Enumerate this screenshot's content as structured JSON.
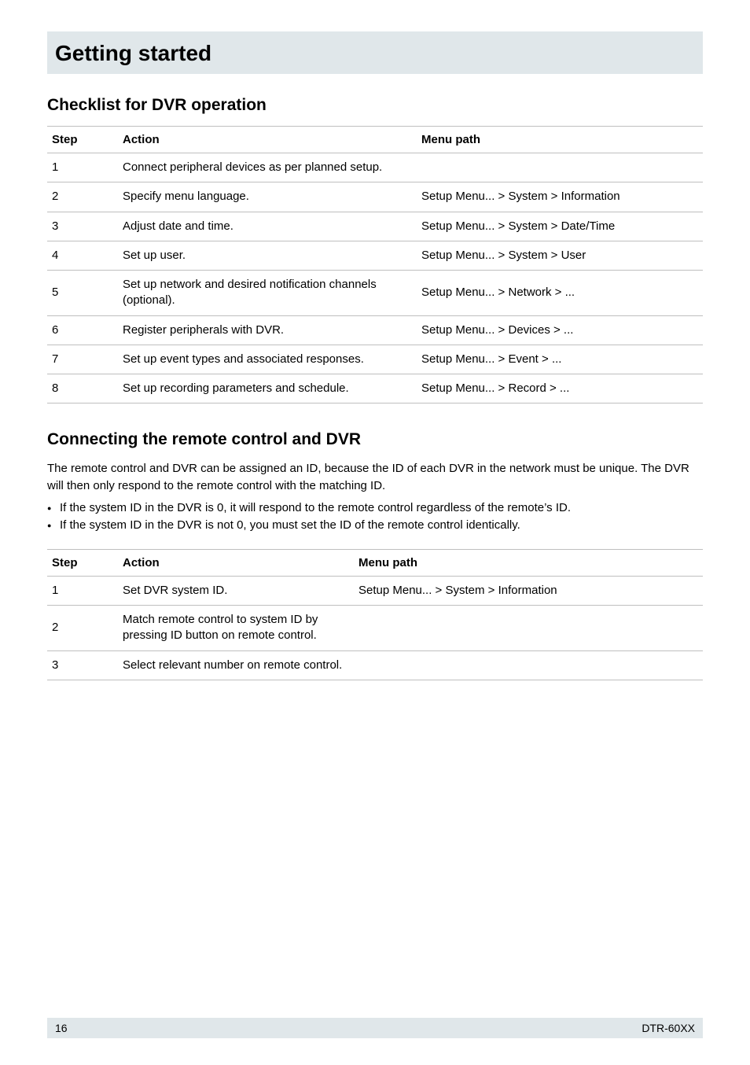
{
  "title": "Getting started",
  "section1": {
    "heading": "Checklist for DVR operation",
    "headers": {
      "step": "Step",
      "action": "Action",
      "menu": "Menu path"
    },
    "rows": [
      {
        "step": "1",
        "action": "Connect peripheral devices as per planned setup.",
        "menu": ""
      },
      {
        "step": "2",
        "action": "Specify menu language.",
        "menu": "Setup Menu... > System > Information"
      },
      {
        "step": "3",
        "action": "Adjust date and time.",
        "menu": "Setup Menu... > System > Date/Time"
      },
      {
        "step": "4",
        "action": "Set up user.",
        "menu": "Setup Menu... > System > User"
      },
      {
        "step": "5",
        "action": "Set up network and desired notification channels (optional).",
        "menu": "Setup Menu... > Network > ..."
      },
      {
        "step": "6",
        "action": "Register peripherals with DVR.",
        "menu": "Setup Menu... > Devices > ..."
      },
      {
        "step": "7",
        "action": "Set up event types and associated responses.",
        "menu": "Setup Menu... > Event > ..."
      },
      {
        "step": "8",
        "action": "Set up recording parameters and schedule.",
        "menu": "Setup Menu... > Record > ..."
      }
    ]
  },
  "section2": {
    "heading": "Connecting the remote control and DVR",
    "intro": "The remote control and DVR can be assigned an ID, because the ID of each DVR in the network must be unique. The DVR will then only respond to the remote control with the matching ID.",
    "bullets": [
      "If the system ID in the DVR is 0, it will respond to the remote control regardless of the remote’s ID.",
      "If the system ID in the DVR is not 0, you must set the ID of the remote control identically."
    ],
    "headers": {
      "step": "Step",
      "action": "Action",
      "menu": "Menu path"
    },
    "rows": [
      {
        "step": "1",
        "action": "Set DVR system ID.",
        "menu": "Setup Menu... > System > Information"
      },
      {
        "step": "2",
        "action": "Match remote control to system ID by pressing ID button on remote control.",
        "menu": ""
      },
      {
        "step": "3",
        "action": "Select relevant number on remote control.",
        "menu": ""
      }
    ]
  },
  "footer": {
    "page": "16",
    "doc": "DTR-60XX"
  }
}
